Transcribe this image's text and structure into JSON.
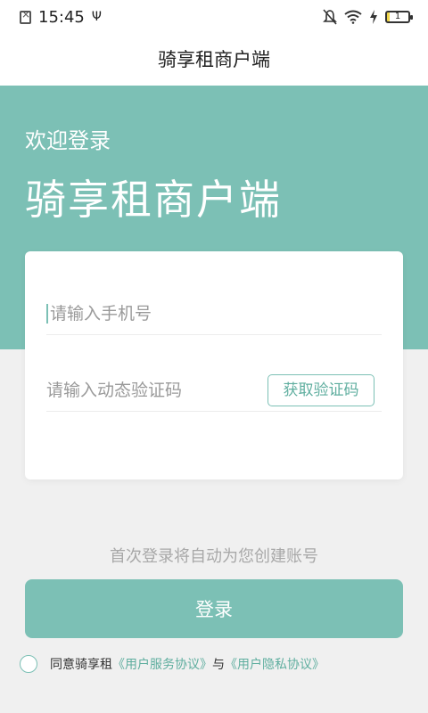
{
  "status_bar": {
    "time": "15:45",
    "usb_symbol": "Ψ",
    "battery_level": "1",
    "icons": [
      "notification-box-icon",
      "usb-icon",
      "mute-icon",
      "wifi-icon",
      "charging-icon",
      "battery-icon"
    ]
  },
  "header": {
    "title": "骑享租商户端"
  },
  "hero": {
    "welcome": "欢迎登录",
    "title": "骑享租商户端",
    "background_color": "#7cc0b5"
  },
  "form": {
    "phone_placeholder": "请输入手机号",
    "code_placeholder": "请输入动态验证码",
    "get_code_label": "获取验证码"
  },
  "hint": "首次登录将自动为您创建账号",
  "login_label": "登录",
  "agreement": {
    "checked": false,
    "prefix": "同意骑享租",
    "service_link": "《用户服务协议》",
    "conjunction": "与",
    "privacy_link": "《用户隐私协议》"
  },
  "colors": {
    "accent": "#7cc0b5",
    "accent_text": "#5fae9f"
  }
}
